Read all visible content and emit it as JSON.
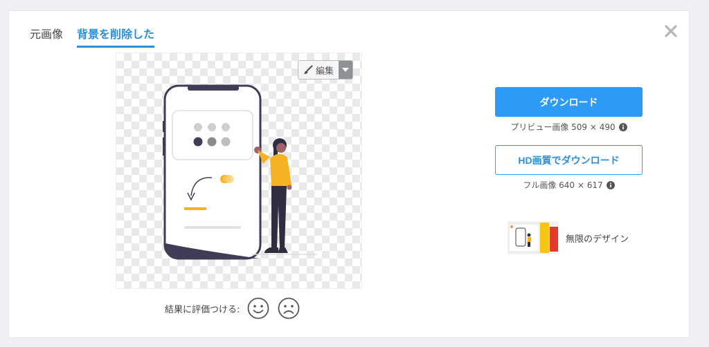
{
  "tabs": [
    {
      "label": "元画像",
      "active": false
    },
    {
      "label": "背景を削除した",
      "active": true
    }
  ],
  "close": {
    "icon": "close-icon"
  },
  "preview": {
    "edit_label": "編集",
    "edit_icon": "brush-icon",
    "dropdown_icon": "caret-down-icon",
    "illustration": "woman-next-to-smartphone"
  },
  "rating": {
    "label": "結果に評価つける:",
    "positive_icon": "smiley-happy-icon",
    "negative_icon": "smiley-sad-icon"
  },
  "download": {
    "primary_label": "ダウンロード",
    "preview_info": "プリビュー画像 509 × 490",
    "hd_label": "HD画質でダウンロード",
    "full_info": "フル画像 640 × 617",
    "info_icon": "info-icon"
  },
  "promo": {
    "label": "無限のデザイン"
  },
  "colors": {
    "accent": "#2d9af5",
    "tab_active": "#2a8fd6",
    "figure_shirt": "#f5b324",
    "phone_dark": "#3f3d56"
  }
}
